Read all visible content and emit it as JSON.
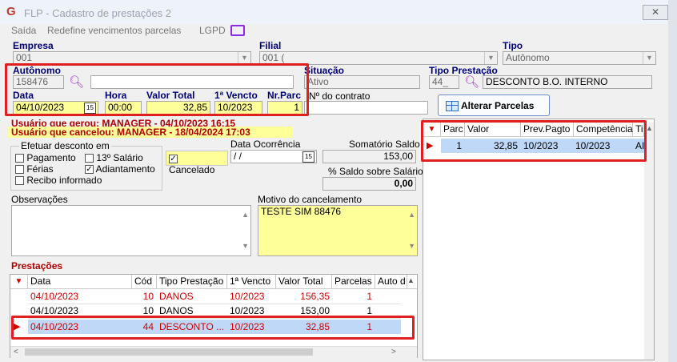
{
  "window": {
    "title": "FLP - Cadastro de prestações 2",
    "close": "✕"
  },
  "menu": {
    "saida": "Saída",
    "redefine": "Redefine vencimentos parcelas",
    "lgpd": "LGPD"
  },
  "empresa": {
    "label": "Empresa",
    "value": "001"
  },
  "filial": {
    "label": "Filial",
    "value": "001 ("
  },
  "tipo": {
    "label": "Tipo",
    "value": "Autônomo"
  },
  "autonomo": {
    "label": "Autônomo",
    "value": "158476",
    "name": ""
  },
  "situacao": {
    "label": "Situação",
    "value": "Ativo"
  },
  "tipo_prestacao": {
    "label": "Tipo Prestação",
    "code": "44_",
    "value": "DESCONTO B.O. INTERNO"
  },
  "data": {
    "label": "Data",
    "value": "04/10/2023"
  },
  "hora": {
    "label": "Hora",
    "value": "00:00"
  },
  "valor_total": {
    "label": "Valor Total",
    "value": "32,85"
  },
  "primeiro_vencto": {
    "label": "1ª Vencto",
    "value": "10/2023"
  },
  "nr_parc": {
    "label": "Nr.Parc",
    "value": "1"
  },
  "contrato": {
    "label": "Nº do contrato",
    "value": ""
  },
  "alterar_parcelas": {
    "label": "Alterar Parcelas"
  },
  "info": {
    "gerou": "Usuário que gerou: MANAGER - 04/10/2023 16:15",
    "cancelou": "Usuário que cancelou: MANAGER - 18/04/2024 17:03"
  },
  "desconto": {
    "title": "Efetuar desconto em",
    "pagamento": "Pagamento",
    "decimo": "13º Salário",
    "ferias": "Férias",
    "adiantamento": "Adiantamento",
    "recibo": "Recibo informado"
  },
  "cancelado": {
    "label": "Cancelado"
  },
  "data_ocorrencia": {
    "label": "Data Ocorrência",
    "value": " / /"
  },
  "somatorio": {
    "label": "Somatório Saldo",
    "value": "153,00"
  },
  "saldo_pct": {
    "label": "% Saldo sobre Salário",
    "value": "0,00"
  },
  "observacoes": {
    "label": "Observações",
    "value": ""
  },
  "motivo": {
    "label": "Motivo do cancelamento",
    "value": "TESTE SIM 88476"
  },
  "prestacoes": {
    "label": "Prestações",
    "columns": [
      "Data",
      "Cód",
      "Tipo Prestação",
      "1ª Vencto",
      "Valor Total",
      "Parcelas",
      "Auto d"
    ],
    "rows": [
      [
        "04/10/2023",
        "10",
        "DANOS",
        "10/2023",
        "156,35",
        "1"
      ],
      [
        "04/10/2023",
        "10",
        "DANOS",
        "10/2023",
        "153,00",
        "1"
      ],
      [
        "04/10/2023",
        "44",
        "DESCONTO ...",
        "10/2023",
        "32,85",
        "1"
      ]
    ]
  },
  "parcelas": {
    "columns": [
      "Parc",
      "Valor",
      "Prev.Pagto",
      "Competência",
      "Ti"
    ],
    "rows": [
      [
        "1",
        "32,85",
        "10/2023",
        "10/2023",
        "AI"
      ]
    ]
  }
}
